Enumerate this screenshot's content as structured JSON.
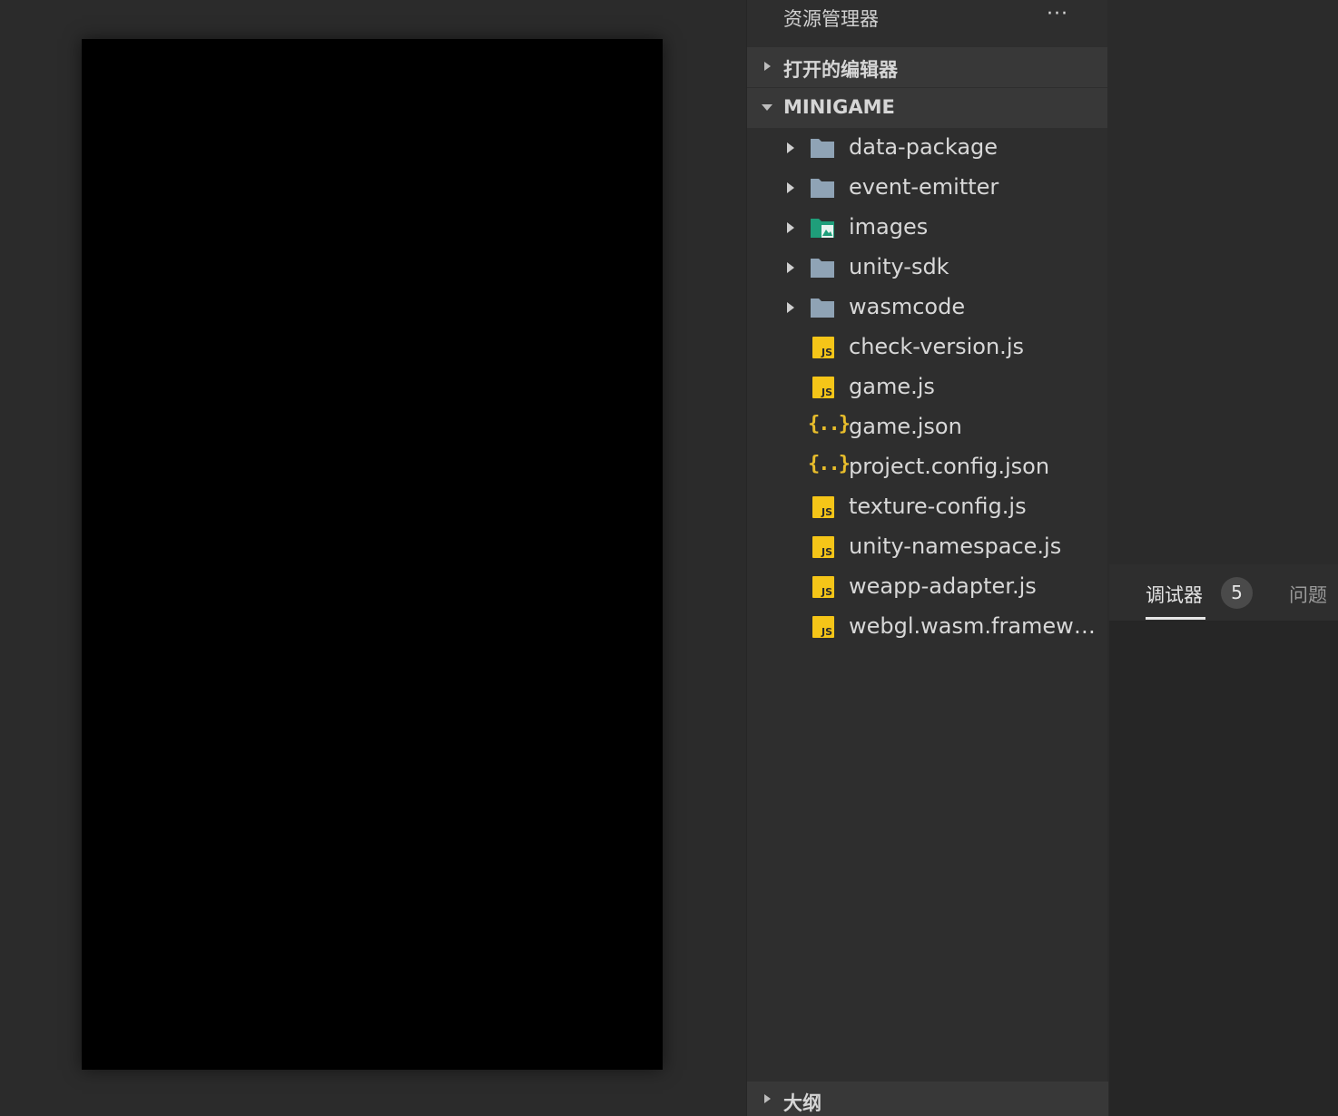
{
  "explorer": {
    "title": "资源管理器",
    "more_label": "···",
    "open_editors_label": "打开的编辑器",
    "project_label": "MINIGAME",
    "outline_label": "大纲"
  },
  "tree": {
    "folders": [
      {
        "name": "data-package",
        "icon": "folder-icon"
      },
      {
        "name": "event-emitter",
        "icon": "folder-icon"
      },
      {
        "name": "images",
        "icon": "images-folder-icon"
      },
      {
        "name": "unity-sdk",
        "icon": "folder-icon"
      },
      {
        "name": "wasmcode",
        "icon": "folder-icon"
      }
    ],
    "files": [
      {
        "name": "check-version.js",
        "type": "js"
      },
      {
        "name": "game.js",
        "type": "js"
      },
      {
        "name": "game.json",
        "type": "json"
      },
      {
        "name": "project.config.json",
        "type": "json"
      },
      {
        "name": "texture-config.js",
        "type": "js"
      },
      {
        "name": "unity-namespace.js",
        "type": "js"
      },
      {
        "name": "weapp-adapter.js",
        "type": "js"
      },
      {
        "name": "webgl.wasm.framewor...",
        "type": "js"
      }
    ]
  },
  "icons": {
    "js_label": "JS",
    "json_label": "{..}"
  },
  "debug": {
    "tab_debugger": "调试器",
    "badge_count": "5",
    "tab_problems": "问题"
  },
  "colors": {
    "folder": "#8fa3b5",
    "images_folder": "#1f9e7a",
    "js_badge": "#f5c518",
    "json_brace": "#e8bd2b"
  }
}
